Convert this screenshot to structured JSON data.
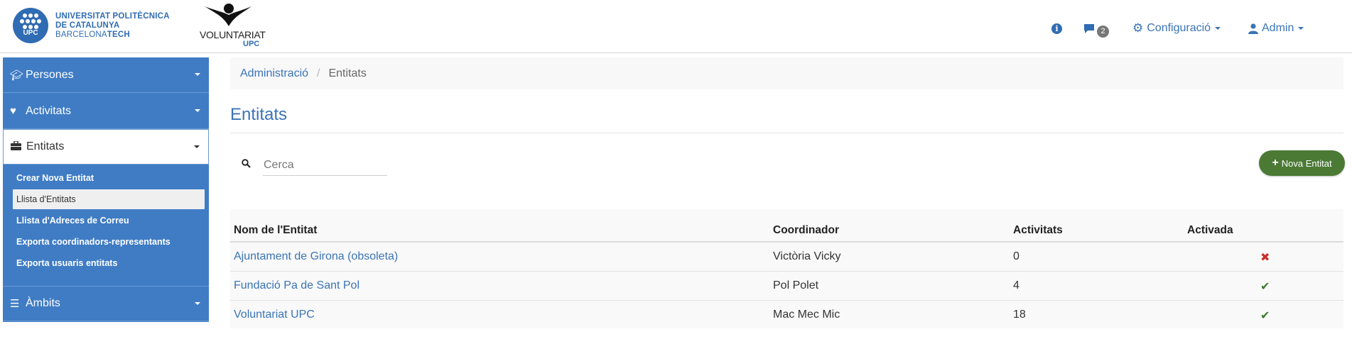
{
  "header": {
    "upc_logo": {
      "emblem_text": "UPC",
      "line1": "UNIVERSITAT POLITÈCNICA",
      "line2": "DE CATALUNYA",
      "line3a": "BARCELONA",
      "line3b": "TECH"
    },
    "voluntariat_logo": {
      "word": "VOLUNTARIAT",
      "sub": "UPC"
    },
    "info_icon": "info-icon",
    "messages": {
      "icon": "comment-icon",
      "count": "2"
    },
    "config": {
      "icon": "gear-icon",
      "label": "Configuració"
    },
    "user": {
      "icon": "user-icon",
      "label": "Admin"
    }
  },
  "sidebar": {
    "panels": [
      {
        "label": "Persones",
        "icon": "graduation-cap-icon"
      },
      {
        "label": "Activitats",
        "icon": "heart-icon"
      },
      {
        "label": "Entitats",
        "icon": "briefcase-icon"
      },
      {
        "label": "Àmbits",
        "icon": "list-icon"
      }
    ],
    "entitats_items": [
      {
        "label": "Crear Nova Entitat"
      },
      {
        "label": "Llista d'Entitats"
      },
      {
        "label": "Llista d'Adreces de Correu"
      },
      {
        "label": "Exporta coordinadors-representants"
      },
      {
        "label": "Exporta usuaris entitats"
      }
    ]
  },
  "breadcrumb": {
    "parent": "Administració",
    "separator": "/",
    "current": "Entitats"
  },
  "page": {
    "title": "Entitats"
  },
  "search": {
    "placeholder": "Cerca",
    "value": ""
  },
  "new_button": {
    "label": "Nova Entitat"
  },
  "table": {
    "headers": [
      "Nom de l'Entitat",
      "Coordinador",
      "Activitats",
      "Activada"
    ],
    "rows": [
      {
        "name": "Ajuntament de Girona (obsoleta)",
        "coordinator": "Victòria Vicky",
        "activities": "0",
        "active": false
      },
      {
        "name": "Fundació Pa de Sant Pol",
        "coordinator": "Pol Polet",
        "activities": "4",
        "active": true
      },
      {
        "name": "Voluntariat UPC",
        "coordinator": "Mac Mec Mic",
        "activities": "18",
        "active": true
      }
    ]
  },
  "colors": {
    "brand_blue": "#3a74b6",
    "sidebar_blue": "#3f7cc4",
    "success_green": "#4b7a35",
    "danger_red": "#c9302c"
  }
}
